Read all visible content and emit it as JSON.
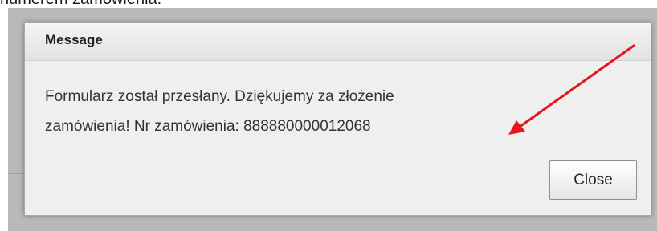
{
  "page": {
    "top_caption": "numerem zamówienia:"
  },
  "dialog": {
    "title": "Message",
    "message_line1": "Formularz został przesłany. Dziękujemy za złożenie",
    "message_line2": "zamówienia! Nr zamówienia: 888880000012068",
    "close_label": "Close"
  },
  "annotation": {
    "arrow_color": "#e3161c"
  },
  "colors": {
    "backdrop": "#b9b9b9",
    "dialog_body": "#efefef",
    "dialog_header": "#e8e8e8"
  }
}
